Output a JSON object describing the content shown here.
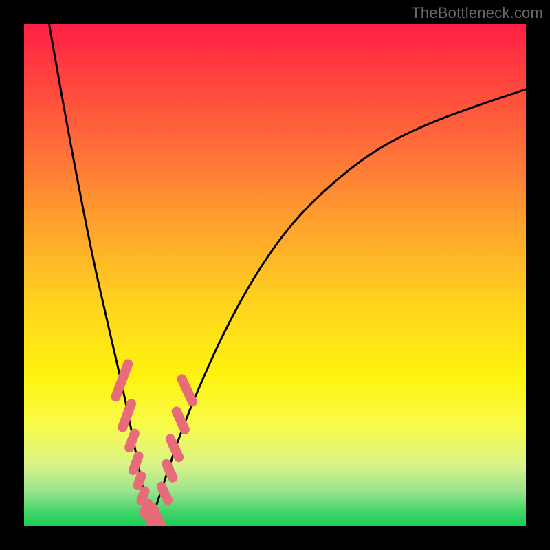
{
  "watermark": {
    "text": "TheBottleneck.com"
  },
  "colors": {
    "curve": "#000000",
    "markers": "#e86b79",
    "markers_stroke": "#c94a5b"
  },
  "chart_data": {
    "type": "line",
    "title": "",
    "xlabel": "",
    "ylabel": "",
    "xlim": [
      0,
      100
    ],
    "ylim": [
      0,
      100
    ],
    "grid": false,
    "note": "V-shaped bottleneck curve. Y ≈ 100·|x − 25|/75 on the right branch; the left branch is a steep concave drop from ~100 at x≈5 down to 0 at x≈25. Minimum (0%) at x≈25.",
    "series": [
      {
        "name": "bottleneck-curve",
        "x": [
          5,
          8,
          11,
          14,
          17,
          20,
          22,
          24,
          25,
          26,
          28,
          31,
          35,
          40,
          46,
          53,
          61,
          70,
          80,
          91,
          100
        ],
        "y": [
          100,
          83,
          67,
          52,
          39,
          26,
          16,
          6,
          0,
          3,
          9,
          18,
          28,
          39,
          50,
          60,
          68,
          75,
          80,
          84,
          87
        ]
      }
    ],
    "markers": {
      "name": "highlighted-points",
      "note": "Pink dot/capsule markers clustered on both branches near the minimum",
      "points": [
        {
          "x": 19.5,
          "y": 29,
          "len": 7
        },
        {
          "x": 20.5,
          "y": 22,
          "len": 5
        },
        {
          "x": 21.5,
          "y": 17,
          "len": 3
        },
        {
          "x": 22.3,
          "y": 12.5,
          "len": 3
        },
        {
          "x": 23.0,
          "y": 9,
          "len": 2
        },
        {
          "x": 23.7,
          "y": 6,
          "len": 2
        },
        {
          "x": 24.3,
          "y": 3.5,
          "len": 2
        },
        {
          "x": 25.0,
          "y": 1.5,
          "len": 4
        },
        {
          "x": 26.5,
          "y": 1.8,
          "len": 4
        },
        {
          "x": 28.0,
          "y": 6.5,
          "len": 3
        },
        {
          "x": 29.0,
          "y": 11,
          "len": 3
        },
        {
          "x": 30.0,
          "y": 15.5,
          "len": 4
        },
        {
          "x": 31.2,
          "y": 21,
          "len": 4
        },
        {
          "x": 32.5,
          "y": 27,
          "len": 5
        }
      ]
    }
  }
}
